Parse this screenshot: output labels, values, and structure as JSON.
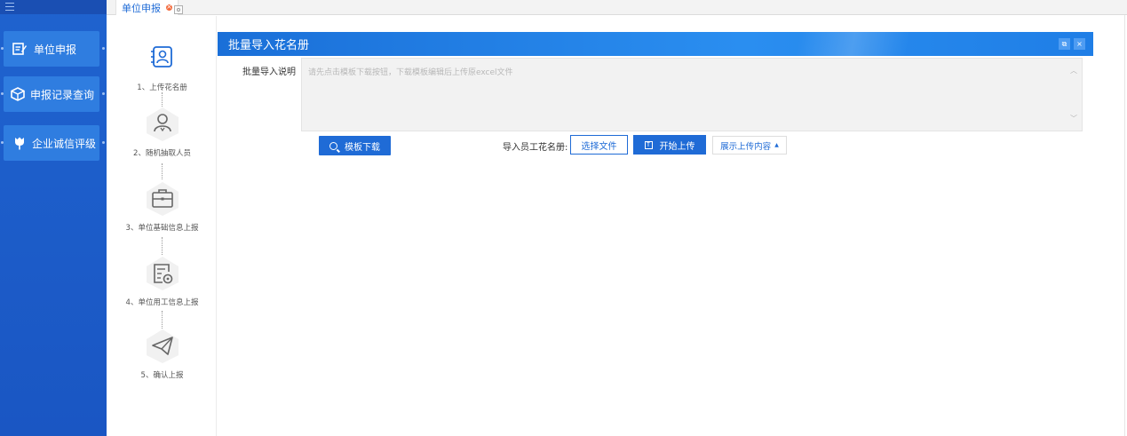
{
  "sidebar": {
    "items": [
      {
        "label": "单位申报",
        "icon": "edit-document-icon"
      },
      {
        "label": "申报记录查询",
        "icon": "box-icon"
      },
      {
        "label": "企业诚信评级",
        "icon": "tulip-icon"
      }
    ]
  },
  "tabs": [
    {
      "label": "单位申报"
    }
  ],
  "steps": [
    {
      "label": "1、上传花名册",
      "icon": "roster-icon"
    },
    {
      "label": "2、随机抽取人员",
      "icon": "person-icon"
    },
    {
      "label": "3、单位基础信息上报",
      "icon": "briefcase-icon"
    },
    {
      "label": "4、单位用工信息上报",
      "icon": "report-icon"
    },
    {
      "label": "5、确认上报",
      "icon": "paper-plane-icon"
    }
  ],
  "panel": {
    "title": "批量导入花名册",
    "desc_label": "批量导入说明",
    "desc_placeholder": "请先点击模板下载按钮，下载模板编辑后上传原excel文件",
    "template_btn": "模板下载",
    "import_label": "导入员工花名册:",
    "choose_btn": "选择文件",
    "upload_btn": "开始上传",
    "show_btn": "展示上传内容"
  },
  "colors": {
    "sidebar": "#1f63cf",
    "accent": "#1f6bd6",
    "header": "#2a8ef0"
  }
}
